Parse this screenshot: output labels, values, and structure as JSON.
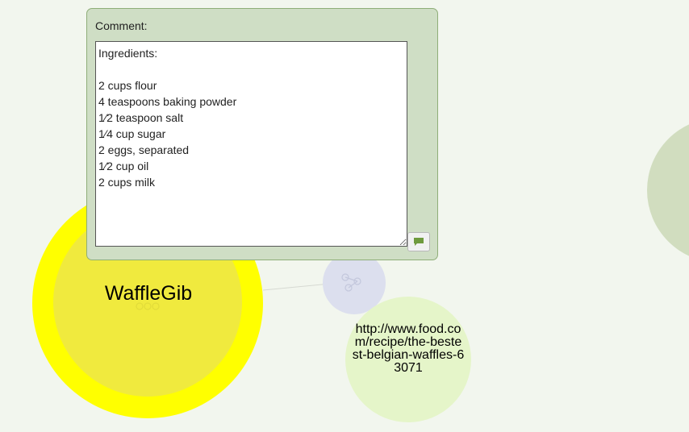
{
  "graph": {
    "main_node": {
      "label": "WaffleGib",
      "ring_color": "#ffff00",
      "fill_color": "#f0ea3e"
    },
    "hub_node": {
      "color": "#dcdfee"
    },
    "url_node": {
      "label": "http://www.food.com/recipe/the-bestest-belgian-waffles-63071",
      "color": "#e5f5c9"
    },
    "edge_partial_node": {
      "color": "#d1ddbf"
    }
  },
  "comment_panel": {
    "heading": "Comment:",
    "text": "Ingredients:\n\n2 cups flour\n4 teaspoons baking powder\n1⁄2 teaspoon salt\n1⁄4 cup sugar\n2 eggs, separated\n1⁄2 cup oil\n2 cups milk",
    "send_icon": "comment-icon",
    "accent_color": "#6f9a3e"
  }
}
